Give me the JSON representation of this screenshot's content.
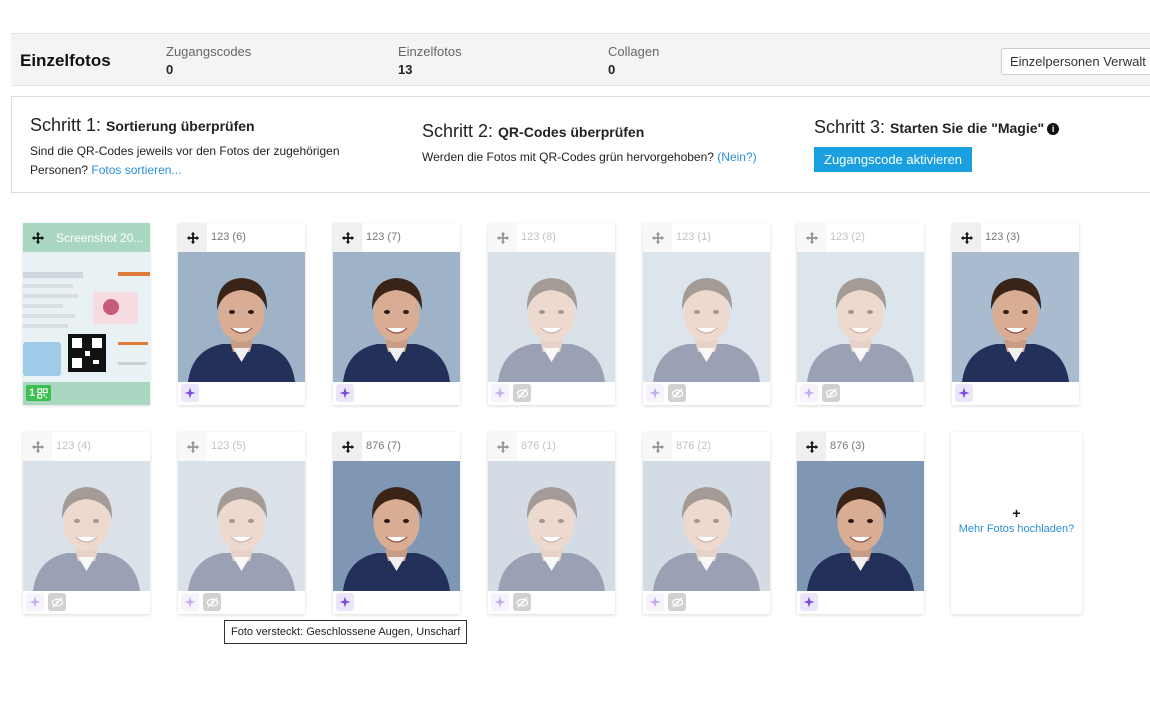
{
  "header": {
    "title": "Einzelfotos",
    "stats": [
      {
        "label": "Zugangscodes",
        "value": "0"
      },
      {
        "label": "Einzelfotos",
        "value": "13"
      },
      {
        "label": "Collagen",
        "value": "0"
      }
    ],
    "mode_select": "Einzelpersonen Verwalt"
  },
  "steps": {
    "step1": {
      "prefix": "Schritt 1:",
      "title": "Sortierung überprüfen",
      "text": "Sind die QR-Codes jeweils vor den Fotos der zugehörigen Personen?",
      "link": "Fotos sortieren..."
    },
    "step2": {
      "prefix": "Schritt 2:",
      "title": "QR-Codes überprüfen",
      "text": "Werden die Fotos mit QR-Codes grün hervorgehoben?",
      "link": "(Nein?)"
    },
    "step3": {
      "prefix": "Schritt 3:",
      "title": "Starten Sie die \"Magie\"",
      "button": "Zugangscode aktivieren"
    }
  },
  "qr_card": {
    "name": "Screenshot 20...",
    "badge_count": "1"
  },
  "photos": [
    {
      "name": "123 (6)",
      "hidden": false,
      "bg": "#9fb3c8"
    },
    {
      "name": "123 (7)",
      "hidden": false,
      "bg": "#9fb3c8"
    },
    {
      "name": "123 (8)",
      "hidden": true,
      "bg": "#aebfd0"
    },
    {
      "name": "123 (1)",
      "hidden": true,
      "bg": "#b5c6d6"
    },
    {
      "name": "123 (2)",
      "hidden": true,
      "bg": "#b5c6d6"
    },
    {
      "name": "123 (3)",
      "hidden": false,
      "bg": "#a9bbcf"
    },
    {
      "name": "123 (4)",
      "hidden": true,
      "bg": "#aebdcd"
    },
    {
      "name": "123 (5)",
      "hidden": true,
      "bg": "#aebdcd"
    },
    {
      "name": "876 (7)",
      "hidden": false,
      "bg": "#7f97b4"
    },
    {
      "name": "876 (1)",
      "hidden": true,
      "bg": "#9fb0c6"
    },
    {
      "name": "876 (2)",
      "hidden": true,
      "bg": "#9fb0c6"
    },
    {
      "name": "876 (3)",
      "hidden": false,
      "bg": "#7f97b4"
    }
  ],
  "upload": {
    "plus": "+",
    "label": "Mehr Fotos hochladen?"
  },
  "tooltip": "Foto versteckt: Geschlossene Augen, Unscharf",
  "colors": {
    "accent": "#1aa0e0",
    "link": "#2a8fd6",
    "qr_green": "#a9d7c1",
    "magic_purple": "#7b4be0"
  },
  "icons": {
    "drag": "move-icon",
    "magic": "sparkle-icon",
    "hidden": "eye-off-icon",
    "qr": "qr-icon",
    "info": "info-icon"
  }
}
